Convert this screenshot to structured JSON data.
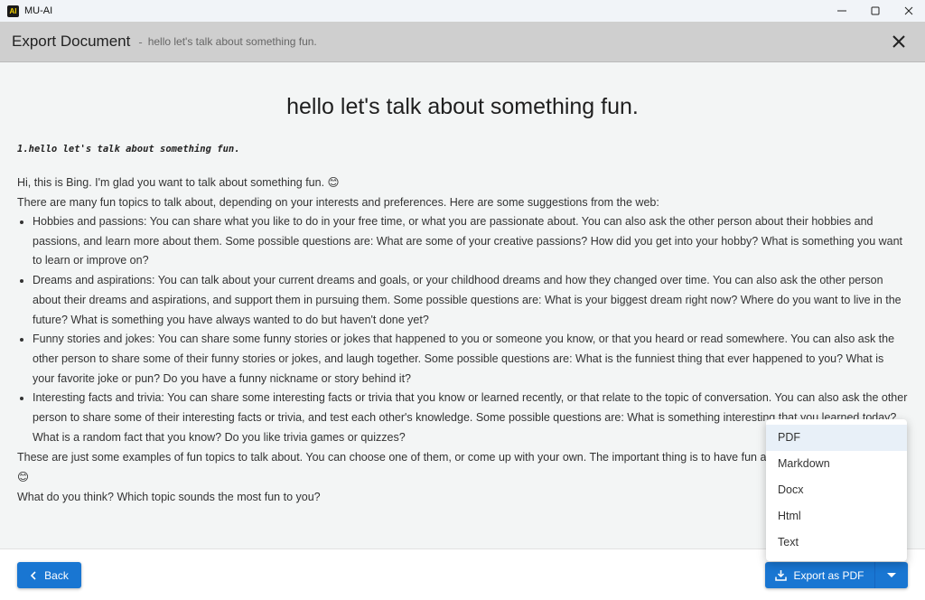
{
  "window": {
    "app_title": "MU-AI",
    "logo_text": "AI"
  },
  "header": {
    "title": "Export Document",
    "separator": "-",
    "subtitle": "hello let's talk about something fun."
  },
  "document": {
    "title": "hello let's talk about something fun.",
    "prompt": "1.hello let's talk about something fun.",
    "intro": "Hi, this is Bing. I'm glad you want to talk about something fun. 😊",
    "lead": "There are many fun topics to talk about, depending on your interests and preferences. Here are some suggestions from the web:",
    "bullets": [
      "Hobbies and passions: You can share what you like to do in your free time, or what you are passionate about. You can also ask the other person about their hobbies and passions, and learn more about them. Some possible questions are: What are some of your creative passions? How did you get into your hobby? What is something you want to learn or improve on?",
      "Dreams and aspirations: You can talk about your current dreams and goals, or your childhood dreams and how they changed over time. You can also ask the other person about their dreams and aspirations, and support them in pursuing them. Some possible questions are: What is your biggest dream right now? Where do you want to live in the future? What is something you have always wanted to do but haven't done yet?",
      "Funny stories and jokes: You can share some funny stories or jokes that happened to you or someone you know, or that you heard or read somewhere. You can also ask the other person to share some of their funny stories or jokes, and laugh together. Some possible questions are: What is the funniest thing that ever happened to you? What is your favorite joke or pun? Do you have a funny nickname or story behind it?",
      "Interesting facts and trivia: You can share some interesting facts or trivia that you know or learned recently, or that relate to the topic of conversation. You can also ask the other person to share some of their interesting facts or trivia, and test each other's knowledge. Some possible questions are: What is something interesting that you learned today? What is a random fact that you know? Do you like trivia games or quizzes?"
    ],
    "closing": "These are just some examples of fun topics to talk about. You can choose one of them, or come up with your own. The important thing is to have fun and enjoy the conversation. 😊",
    "question": "What do you think? Which topic sounds the most fun to you?"
  },
  "footer": {
    "back_label": "Back",
    "export_label": "Export as PDF"
  },
  "export_menu": {
    "items": [
      "PDF",
      "Markdown",
      "Docx",
      "Html",
      "Text"
    ],
    "selected": "PDF"
  },
  "colors": {
    "accent": "#1976d2",
    "header_bg": "#cfcfcf",
    "content_bg": "#f3f5f5"
  }
}
